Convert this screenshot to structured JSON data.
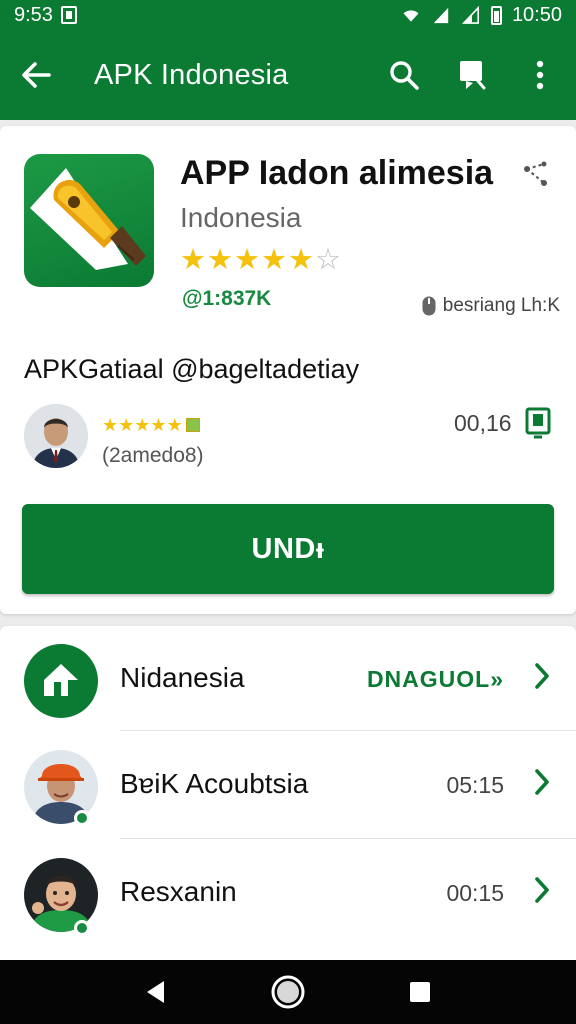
{
  "status_bar": {
    "time_left": "9:53",
    "time_right": "10:50",
    "icons": [
      "notification-icon",
      "wifi-icon",
      "signal-icon",
      "signal-icon",
      "battery-icon"
    ]
  },
  "app_bar": {
    "title": "APK Indonesia",
    "icons": [
      "back-arrow-icon",
      "search-icon",
      "bookmark-icon",
      "more-vert-icon"
    ]
  },
  "app_card": {
    "title": "APP Iadon alimesia",
    "subtitle": "Indonesia",
    "rating": 4.5,
    "rating_max": 5,
    "count": "@1:837K",
    "developer": "besriang Lh:K",
    "headline": "APKGatiaal @bageltadetiay",
    "review": {
      "handle": "(2amedo8)",
      "time": "00,16"
    },
    "cta_label": "UNDᵻ"
  },
  "list": [
    {
      "label": "Nidanesia",
      "meta": "DNAGUOL»",
      "meta_style": "green",
      "avatar": "upload-arrow-icon"
    },
    {
      "label": "BɐiK Acoubtsia",
      "meta": "05:15",
      "avatar": "avatar-man-hardhat"
    },
    {
      "label": "Resxanin",
      "meta": "00:15",
      "avatar": "avatar-child"
    }
  ],
  "colors": {
    "primary": "#0b7a33",
    "star": "#f4c20d",
    "background": "#ececec"
  },
  "nav_bar": {
    "icons": [
      "back-triangle-icon",
      "home-circle-icon",
      "recents-square-icon"
    ]
  }
}
